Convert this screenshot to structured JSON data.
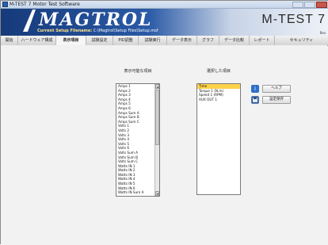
{
  "window": {
    "title": "M-TEST 7 Motor Test Software"
  },
  "brand": {
    "logo": "MAGTROL",
    "setup_label": "Current Setup Filename:",
    "setup_file": "C:\\Magtrol\\Setup Files\\Setup.msf",
    "product": "M-TEST 7",
    "rev": "Rev."
  },
  "tabs": [
    "開始",
    "ハードウェア構成",
    "表示項目",
    "試験設定",
    "PID調整",
    "試験実行",
    "データ表示",
    "グラフ",
    "データ比較",
    "レポート",
    "セキュリティ"
  ],
  "available": {
    "label": "表示可能な項目",
    "items": [
      "Amps 1",
      "Amps 2",
      "Amps 3",
      "Amps 4",
      "Amps 5",
      "Amps 6",
      "Amps Sum A",
      "Amps Sum B",
      "Amps Sum C",
      "Volts 1",
      "Volts 2",
      "Volts 3",
      "Volts 4",
      "Volts 5",
      "Volts 6",
      "Volts Sum A",
      "Volts Sum B",
      "Volts Sum C",
      "Watts IN 1",
      "Watts IN 2",
      "Watts IN 3",
      "Watts IN 4",
      "Watts IN 5",
      "Watts IN 6",
      "Watts IN Sum A"
    ]
  },
  "selected": {
    "label": "選択した項目",
    "items": [
      "Time",
      "Torque 1 (N.m)",
      "Speed 1 (RPM)",
      "AUX OUT 1"
    ],
    "highlighted_index": 0
  },
  "buttons": {
    "help": {
      "label": "ヘルプ",
      "icon": "info-icon",
      "color": "#2f6fc9"
    },
    "save": {
      "label": "設定保存",
      "icon": "save-icon",
      "color": "#5a7fb5"
    }
  }
}
